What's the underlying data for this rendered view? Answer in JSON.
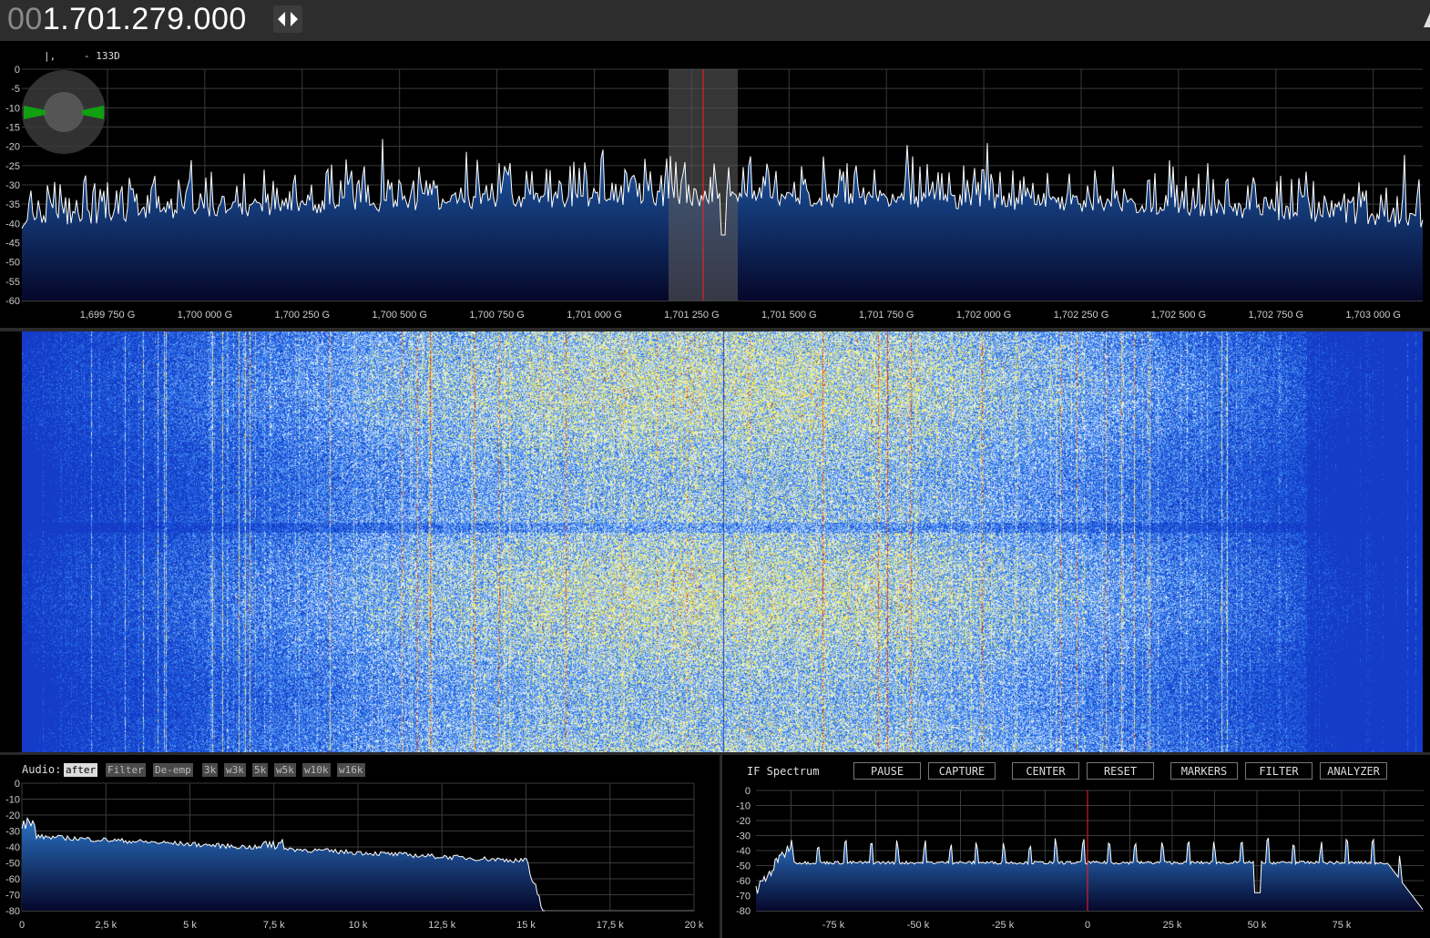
{
  "header": {
    "freq_dim": "00",
    "freq_main": "1.701.279.000"
  },
  "spectrum": {
    "mode_indicator": "|,",
    "readout": "- 133D",
    "y_ticks": [
      "0",
      "-5",
      "-10",
      "-15",
      "-20",
      "-25",
      "-30",
      "-35",
      "-40",
      "-45",
      "-50",
      "-55",
      "-60"
    ],
    "x_ticks": [
      "1,699 750 G",
      "1,700 000 G",
      "1,700 250 G",
      "1,700 500 G",
      "1,700 750 G",
      "1,701 000 G",
      "1,701 250 G",
      "1,701 500 G",
      "1,701 750 G",
      "1,702 000 G",
      "1,702 250 G",
      "1,702 500 G",
      "1,702 750 G",
      "1,703 000 G"
    ],
    "noise_floor_db": -38,
    "colors": {
      "fill_top": "#1f5fb0",
      "fill_bottom": "#05072a",
      "trace": "#ffffff",
      "marker": "#ff2020",
      "passband": "#5a5a5a"
    }
  },
  "audio": {
    "label": "Audio:",
    "buttons": [
      "after",
      "Filter",
      "De-emp",
      "3k",
      "w3k",
      "5k",
      "w5k",
      "w10k",
      "w16k"
    ],
    "active_button": "after",
    "y_ticks": [
      "0",
      "-10",
      "-20",
      "-30",
      "-40",
      "-50",
      "-60",
      "-70",
      "-80"
    ],
    "x_ticks": [
      "0",
      "2,5 k",
      "5 k",
      "7,5 k",
      "10 k",
      "12,5 k",
      "15 k",
      "17,5 k",
      "20 k"
    ]
  },
  "if_spectrum": {
    "title": "IF Spectrum",
    "buttons": [
      "PAUSE",
      "CAPTURE",
      "CENTER",
      "RESET",
      "MARKERS",
      "FILTER",
      "ANALYZER"
    ],
    "y_ticks": [
      "0",
      "-10",
      "-20",
      "-30",
      "-40",
      "-50",
      "-60",
      "-70",
      "-80"
    ],
    "x_ticks": [
      "-75 k",
      "-50 k",
      "-25 k",
      "0",
      "25 k",
      "50 k",
      "75 k"
    ]
  }
}
